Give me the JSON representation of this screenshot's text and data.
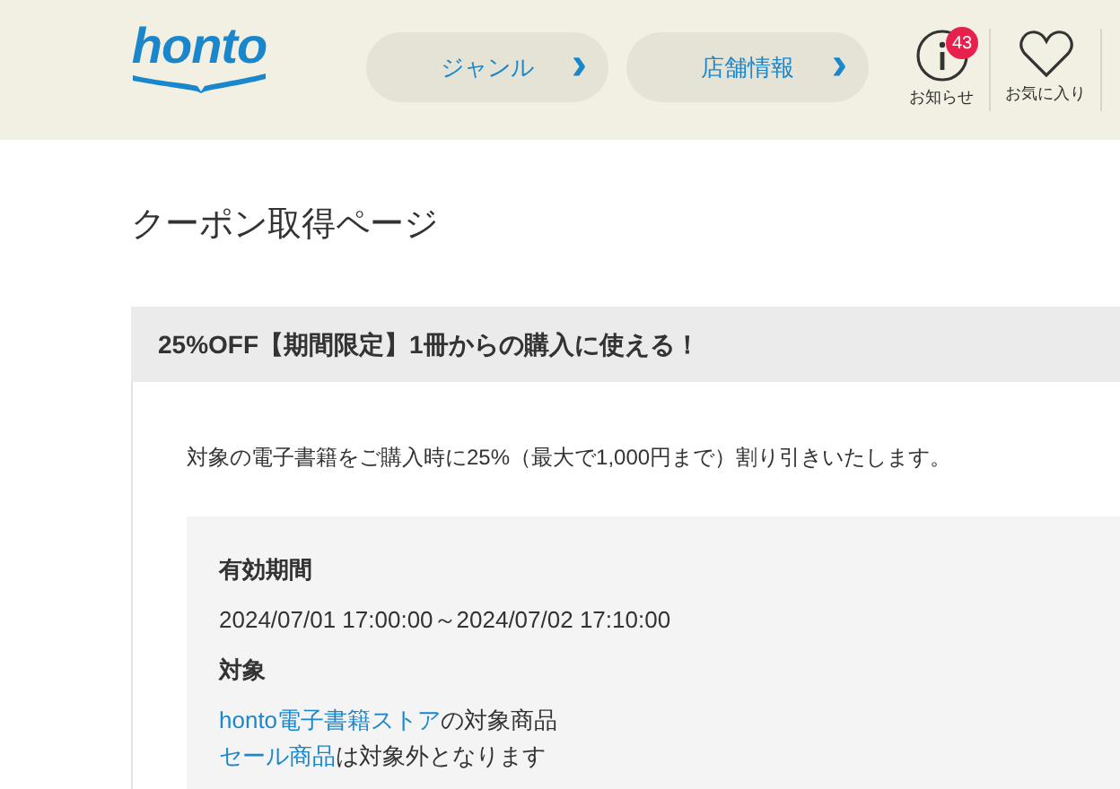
{
  "header": {
    "logo": "honto",
    "nav_buttons": [
      {
        "label": "ジャンル",
        "arrow": "›"
      },
      {
        "label": "店舗情報",
        "arrow": "›"
      }
    ],
    "icons": [
      {
        "kind": "info",
        "label": "お知らせ",
        "badge": "43"
      },
      {
        "kind": "heart",
        "label": "お気に入り"
      }
    ]
  },
  "page_title": "クーポン取得ページ",
  "coupon": {
    "title": "25%OFF【期間限定】1冊からの購入に使える！",
    "description": "対象の電子書籍をご購入時に25%（最大で1,000円まで）割り引きいたします。",
    "details": [
      {
        "kind": "heading",
        "text": "有効期間"
      },
      {
        "kind": "text",
        "text": "2024/07/01 17:00:00～2024/07/02 17:10:00"
      },
      {
        "kind": "heading",
        "text": "対象"
      },
      {
        "kind": "link_line",
        "link": "honto電子書籍ストア",
        "rest": "の対象商品"
      },
      {
        "kind": "link_line",
        "link": "セール商品",
        "rest": "は対象外となります"
      }
    ]
  }
}
